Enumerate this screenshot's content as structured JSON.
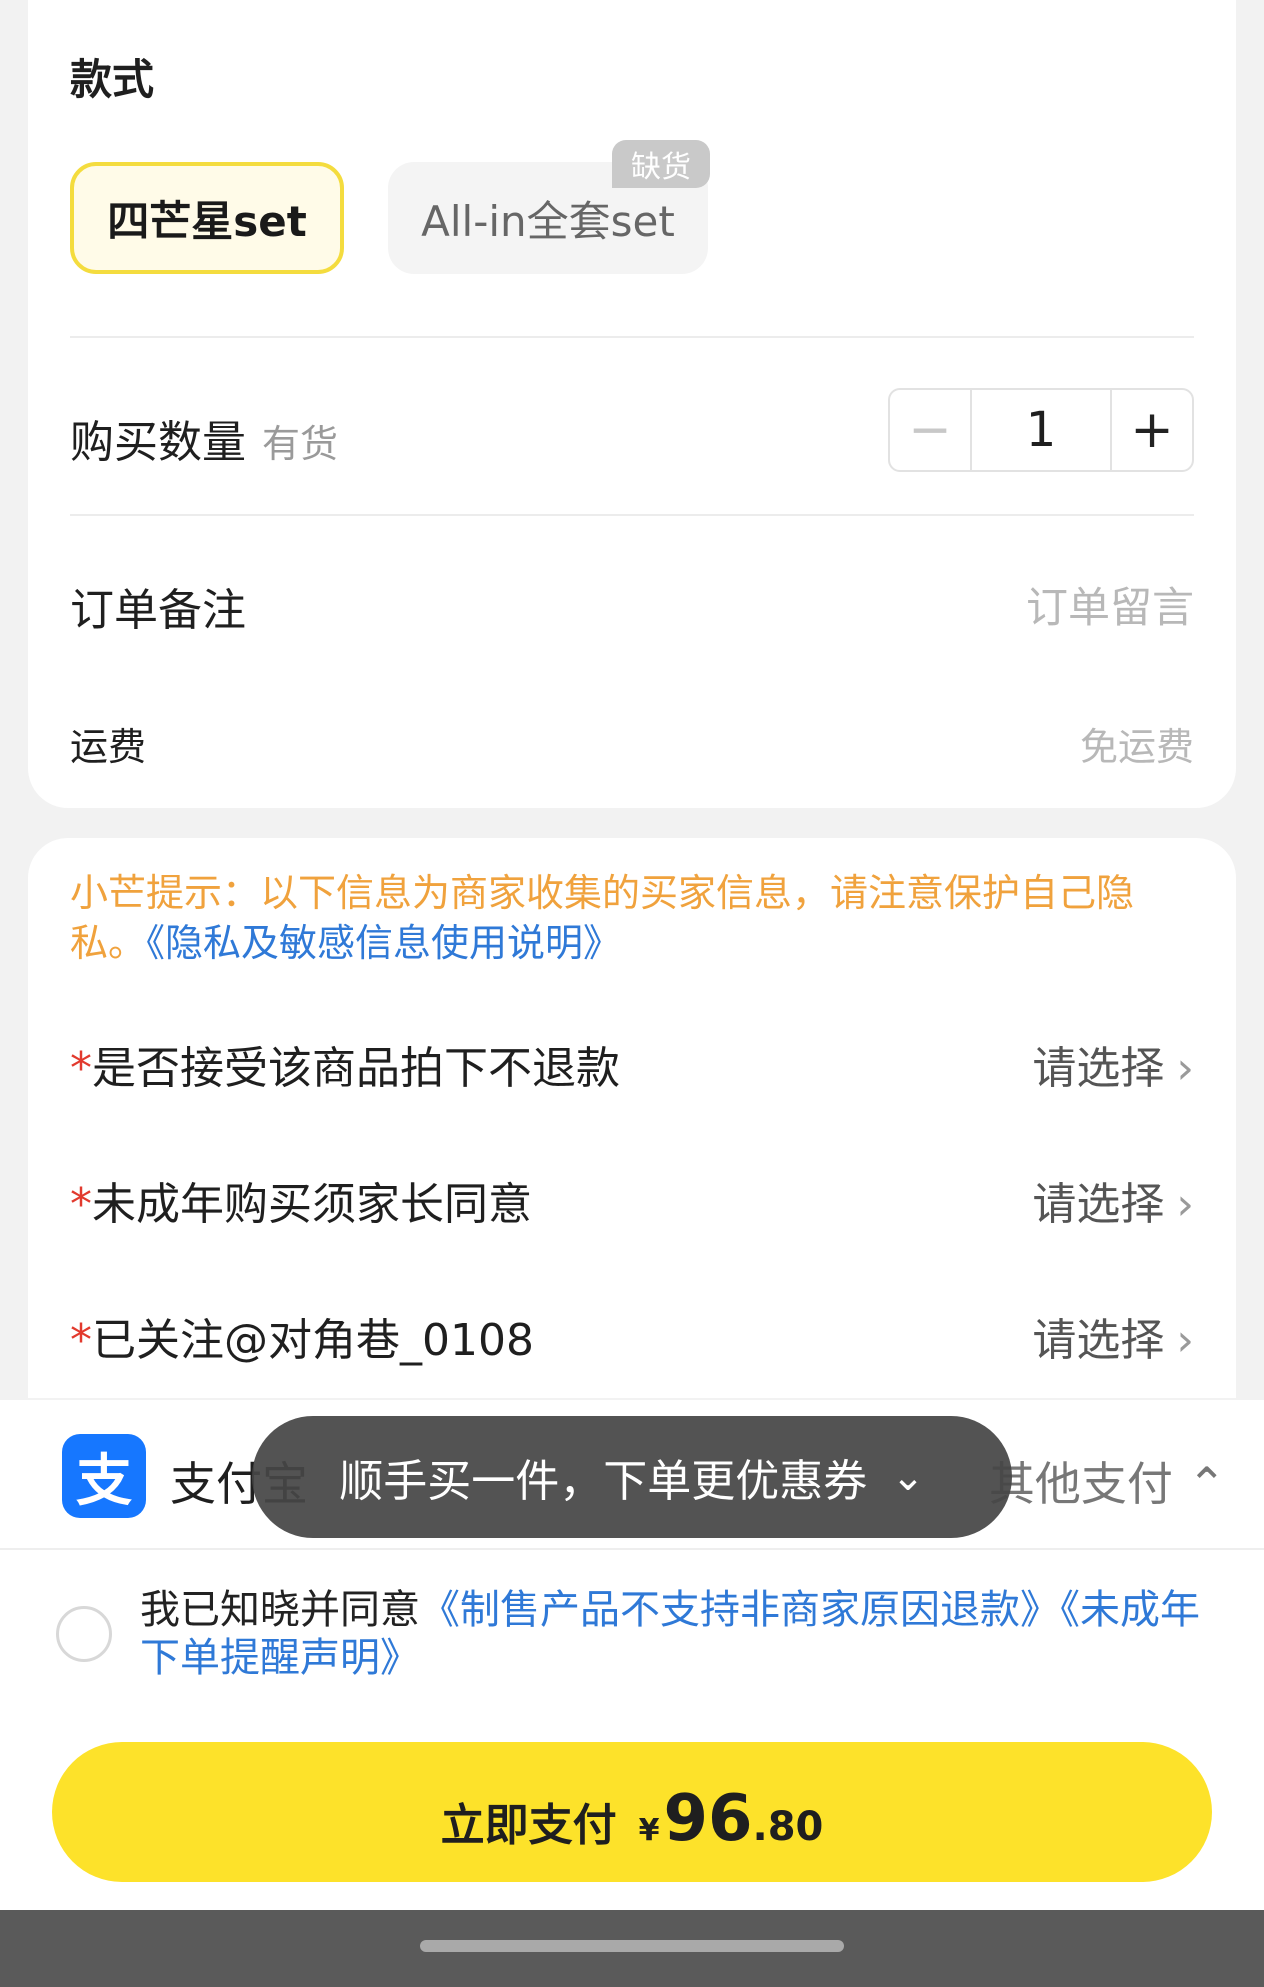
{
  "style_section": {
    "title": "款式",
    "options": [
      {
        "label": "四芒星set",
        "selected": true
      },
      {
        "label": "All-in全套set",
        "selected": false,
        "tag": "缺货"
      }
    ]
  },
  "quantity": {
    "label": "购买数量",
    "stock": "有货",
    "minus": "−",
    "value": "1",
    "plus": "+"
  },
  "remark": {
    "label": "订单备注",
    "placeholder": "订单留言"
  },
  "shipping": {
    "label": "运费",
    "value": "免运费"
  },
  "notice": {
    "text": "小芒提示：以下信息为商家收集的买家信息，请注意保护自己隐私。",
    "link": "《隐私及敏感信息使用说明》"
  },
  "questions": [
    {
      "required": "*",
      "text": "是否接受该商品拍下不退款",
      "action": "请选择",
      "chevron": "›"
    },
    {
      "required": "*",
      "text": "未成年购买须家长同意",
      "action": "请选择",
      "chevron": "›"
    },
    {
      "required": "*",
      "text": "已关注@对角巷_0108",
      "action": "请选择",
      "chevron": "›"
    }
  ],
  "payment": {
    "logo": "支",
    "method": "支付宝",
    "other": "其他支付",
    "other_chevron": "⌃"
  },
  "toast": {
    "text": "顺手买一件，下单更优惠券",
    "icon": "⌄"
  },
  "agreement": {
    "prefix": "我已知晓并同意",
    "link1": "《制售产品不支持非商家原因退款》",
    "link2": "《未成年下单提醒声明》"
  },
  "pay_button": {
    "label": "立即支付",
    "currency": "¥",
    "integer": "96",
    "decimal": ".80"
  },
  "colors": {
    "accent_yellow": "#fde22a",
    "link_blue": "#2f79d7",
    "notice_orange": "#f0a23d",
    "alipay_blue": "#1677ff"
  }
}
